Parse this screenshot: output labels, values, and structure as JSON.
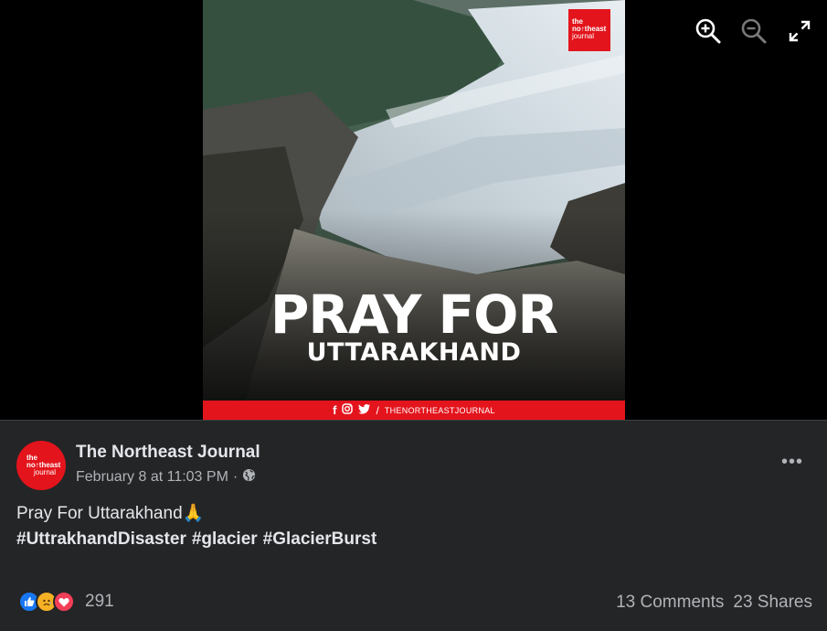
{
  "photo": {
    "headline_line1": "PRAY FOR",
    "headline_line2": "UTTARAKHAND",
    "brand_logo": {
      "line1": "the",
      "line2": "no↑theast",
      "line3": "journal"
    },
    "social_bar": {
      "icons": [
        "facebook-icon",
        "instagram-icon",
        "twitter-icon"
      ],
      "separator": "/",
      "handle": "THENORTHEASTJOURNAL"
    }
  },
  "viewer_tools": [
    {
      "name": "zoom-in-icon"
    },
    {
      "name": "zoom-out-icon"
    },
    {
      "name": "fullscreen-icon"
    }
  ],
  "post": {
    "page_name": "The Northeast Journal",
    "avatar_logo": {
      "line1": "the",
      "line2": "no↑theast",
      "line3": "journal"
    },
    "timestamp": "February 8 at 11:03 PM",
    "meta_separator": "·",
    "audience_icon": "globe-icon",
    "more_label": "•••",
    "caption": "Pray For Uttarakhand🙏",
    "hashtags": [
      "#UttrakhandDisaster",
      "#glacier",
      "#GlacierBurst"
    ],
    "reactions": {
      "types": [
        "like",
        "sad",
        "love"
      ],
      "count": "291"
    },
    "comments": "13 Comments",
    "shares": "23 Shares"
  },
  "colors": {
    "brand_red": "#e3141c",
    "panel_bg": "#242526",
    "primary_text": "#e4e6eb",
    "secondary_text": "#b0b3b8",
    "like_blue": "#1877f2"
  }
}
